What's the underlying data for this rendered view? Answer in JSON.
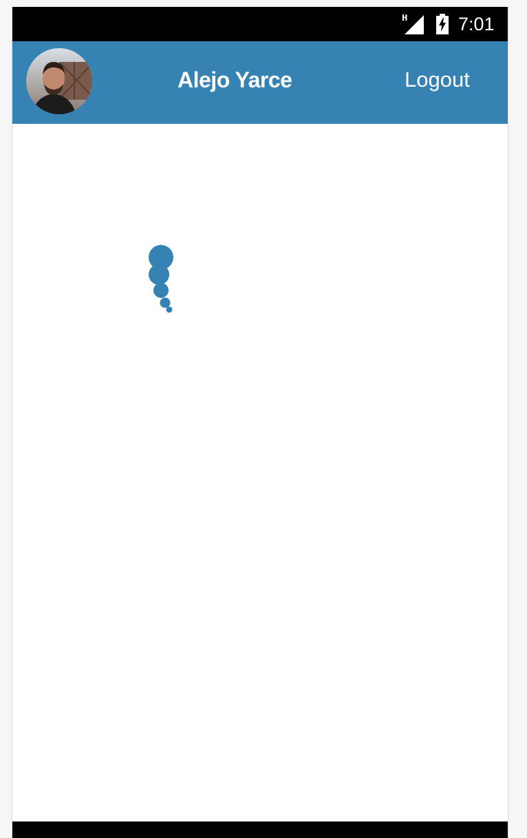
{
  "status_bar": {
    "network_type": "H",
    "time": "7:01",
    "icons": [
      "signal-icon",
      "battery-charging-icon"
    ]
  },
  "app_bar": {
    "user_name": "Alejo Yarce",
    "logout_label": "Logout",
    "background_color": "#3683b3"
  },
  "loading_indicator": {
    "icon": "loading-dots-spinner",
    "color": "#3683b3"
  }
}
